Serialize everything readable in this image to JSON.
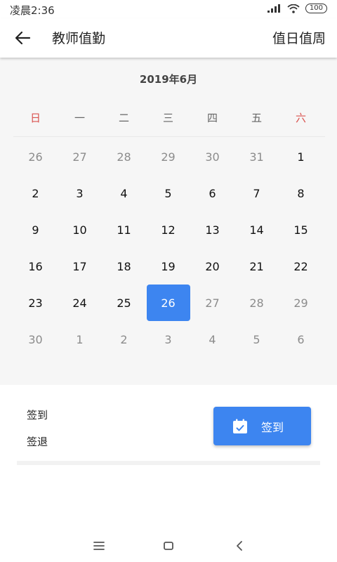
{
  "status": {
    "time": "凌晨2:36",
    "battery": "100"
  },
  "appbar": {
    "title": "教师值勤",
    "action": "值日值周"
  },
  "calendar": {
    "month": "2019年6月",
    "weekdays": [
      "日",
      "一",
      "二",
      "三",
      "四",
      "五",
      "六"
    ],
    "weeks": [
      [
        "26",
        "27",
        "28",
        "29",
        "30",
        "31",
        "1"
      ],
      [
        "2",
        "3",
        "4",
        "5",
        "6",
        "7",
        "8"
      ],
      [
        "9",
        "10",
        "11",
        "12",
        "13",
        "14",
        "15"
      ],
      [
        "16",
        "17",
        "18",
        "19",
        "20",
        "21",
        "22"
      ],
      [
        "23",
        "24",
        "25",
        "26",
        "27",
        "28",
        "29"
      ],
      [
        "30",
        "1",
        "2",
        "3",
        "4",
        "5",
        "6"
      ]
    ],
    "selected_day": "26"
  },
  "sign": {
    "in_label": "签到",
    "out_label": "签退",
    "button_label": "签到"
  },
  "colors": {
    "accent": "#3d85f0",
    "weekend": "#d9534f"
  }
}
